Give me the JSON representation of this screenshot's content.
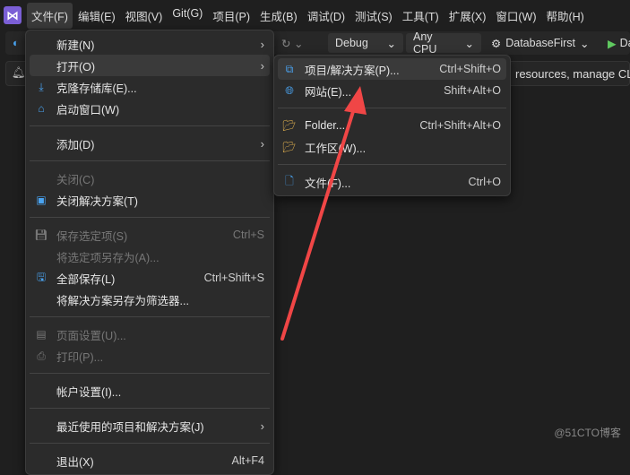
{
  "menubar": {
    "items": [
      "文件(F)",
      "编辑(E)",
      "视图(V)",
      "Git(G)",
      "项目(P)",
      "生成(B)",
      "调试(D)",
      "测试(S)",
      "工具(T)",
      "扩展(X)",
      "窗口(W)",
      "帮助(H)"
    ]
  },
  "toolbar": {
    "config": "Debug",
    "platform": "Any CPU",
    "startup": "DatabaseFirst",
    "run": "Da"
  },
  "infobar": {
    "text": "resources, manage CLI"
  },
  "file_menu": {
    "items": [
      {
        "label": "新建(N)",
        "submenu": true
      },
      {
        "label": "打开(O)",
        "submenu": true,
        "highlight": true
      },
      {
        "label": "克隆存储库(E)...",
        "icon": "clone-repo-icon"
      },
      {
        "label": "启动窗口(W)",
        "icon": "start-window-icon"
      },
      {
        "sep": true
      },
      {
        "label": "添加(D)",
        "submenu": true
      },
      {
        "sep": true
      },
      {
        "label": "关闭(C)",
        "disabled": true
      },
      {
        "label": "关闭解决方案(T)",
        "icon": "close-solution-icon"
      },
      {
        "sep": true
      },
      {
        "label": "保存选定项(S)",
        "shortcut": "Ctrl+S",
        "disabled": true,
        "icon": "save-icon"
      },
      {
        "label": "将选定项另存为(A)...",
        "disabled": true
      },
      {
        "label": "全部保存(L)",
        "shortcut": "Ctrl+Shift+S",
        "icon": "save-all-icon"
      },
      {
        "label": "将解决方案另存为筛选器..."
      },
      {
        "sep": true
      },
      {
        "label": "页面设置(U)...",
        "disabled": true,
        "icon": "page-setup-icon"
      },
      {
        "label": "打印(P)...",
        "disabled": true,
        "icon": "print-icon"
      },
      {
        "sep": true
      },
      {
        "label": "帐户设置(I)..."
      },
      {
        "sep": true
      },
      {
        "label": "最近使用的项目和解决方案(J)",
        "submenu": true
      },
      {
        "sep": true
      },
      {
        "label": "退出(X)",
        "shortcut": "Alt+F4"
      }
    ]
  },
  "open_submenu": {
    "items": [
      {
        "label": "项目/解决方案(P)...",
        "shortcut": "Ctrl+Shift+O",
        "icon": "open-project-icon",
        "highlight": true
      },
      {
        "label": "网站(E)...",
        "shortcut": "Shift+Alt+O",
        "icon": "website-icon"
      },
      {
        "sep": true
      },
      {
        "label": "Folder...",
        "shortcut": "Ctrl+Shift+Alt+O",
        "icon": "open-folder-icon"
      },
      {
        "label": "工作区(W)...",
        "icon": "workspace-icon"
      },
      {
        "sep": true
      },
      {
        "label": "文件(F)...",
        "shortcut": "Ctrl+O",
        "icon": "open-file-icon"
      }
    ]
  },
  "watermark": "@51CTO博客",
  "colors": {
    "accent": "#4aa3f0",
    "arrow": "#f04646"
  }
}
